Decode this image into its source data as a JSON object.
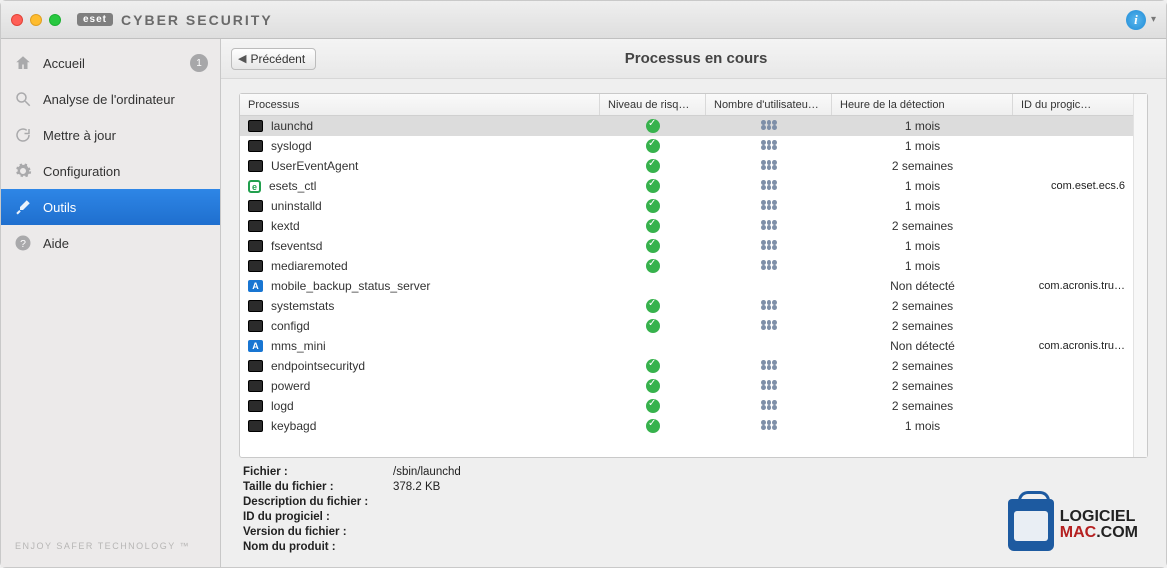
{
  "brand": {
    "badge": "eset",
    "name": "CYBER SECURITY"
  },
  "sidebar": {
    "items": [
      {
        "label": "Accueil",
        "icon": "home",
        "badge": "1"
      },
      {
        "label": "Analyse de l'ordinateur",
        "icon": "search"
      },
      {
        "label": "Mettre à jour",
        "icon": "refresh"
      },
      {
        "label": "Configuration",
        "icon": "gear"
      },
      {
        "label": "Outils",
        "icon": "tools",
        "selected": true
      },
      {
        "label": "Aide",
        "icon": "help"
      }
    ],
    "slogan": "ENJOY SAFER TECHNOLOGY ™"
  },
  "toolbar": {
    "back_label": "Précédent"
  },
  "page_title": "Processus en cours",
  "columns": {
    "proc": "Processus",
    "risk": "Niveau de risq…",
    "users": "Nombre d'utilisateu…",
    "time": "Heure de la détection",
    "id": "ID du progic…"
  },
  "rows": [
    {
      "name": "launchd",
      "icon": "term",
      "risk": true,
      "users": true,
      "time": "1 mois",
      "id": "",
      "selected": true
    },
    {
      "name": "syslogd",
      "icon": "term",
      "risk": true,
      "users": true,
      "time": "1 mois",
      "id": ""
    },
    {
      "name": "UserEventAgent",
      "icon": "term",
      "risk": true,
      "users": true,
      "time": "2 semaines",
      "id": ""
    },
    {
      "name": "esets_ctl",
      "icon": "eset",
      "risk": true,
      "users": true,
      "time": "1 mois",
      "id": "com.eset.ecs.6"
    },
    {
      "name": "uninstalld",
      "icon": "term",
      "risk": true,
      "users": true,
      "time": "1 mois",
      "id": ""
    },
    {
      "name": "kextd",
      "icon": "term",
      "risk": true,
      "users": true,
      "time": "2 semaines",
      "id": ""
    },
    {
      "name": "fseventsd",
      "icon": "term",
      "risk": true,
      "users": true,
      "time": "1 mois",
      "id": ""
    },
    {
      "name": "mediaremoted",
      "icon": "term",
      "risk": true,
      "users": true,
      "time": "1 mois",
      "id": ""
    },
    {
      "name": "mobile_backup_status_server",
      "icon": "acr",
      "risk": false,
      "users": false,
      "time": "Non détecté",
      "id": "com.acronis.tru…"
    },
    {
      "name": "systemstats",
      "icon": "term",
      "risk": true,
      "users": true,
      "time": "2 semaines",
      "id": ""
    },
    {
      "name": "configd",
      "icon": "term",
      "risk": true,
      "users": true,
      "time": "2 semaines",
      "id": ""
    },
    {
      "name": "mms_mini",
      "icon": "acr",
      "risk": false,
      "users": false,
      "time": "Non détecté",
      "id": "com.acronis.tru…"
    },
    {
      "name": "endpointsecurityd",
      "icon": "term",
      "risk": true,
      "users": true,
      "time": "2 semaines",
      "id": ""
    },
    {
      "name": "powerd",
      "icon": "term",
      "risk": true,
      "users": true,
      "time": "2 semaines",
      "id": ""
    },
    {
      "name": "logd",
      "icon": "term",
      "risk": true,
      "users": true,
      "time": "2 semaines",
      "id": ""
    },
    {
      "name": "keybagd",
      "icon": "term",
      "risk": true,
      "users": true,
      "time": "1 mois",
      "id": ""
    }
  ],
  "details": {
    "labels": {
      "file": "Fichier :",
      "size": "Taille du fichier :",
      "desc": "Description du fichier :",
      "pid": "ID du progiciel :",
      "ver": "Version du fichier :",
      "prod": "Nom du produit :"
    },
    "file": "/sbin/launchd",
    "size": "378.2 KB",
    "desc": "",
    "pid": "",
    "ver": "",
    "prod": ""
  },
  "watermark": {
    "l1": "LOGICIEL",
    "l2a": "MAC",
    "l2b": ".COM"
  }
}
